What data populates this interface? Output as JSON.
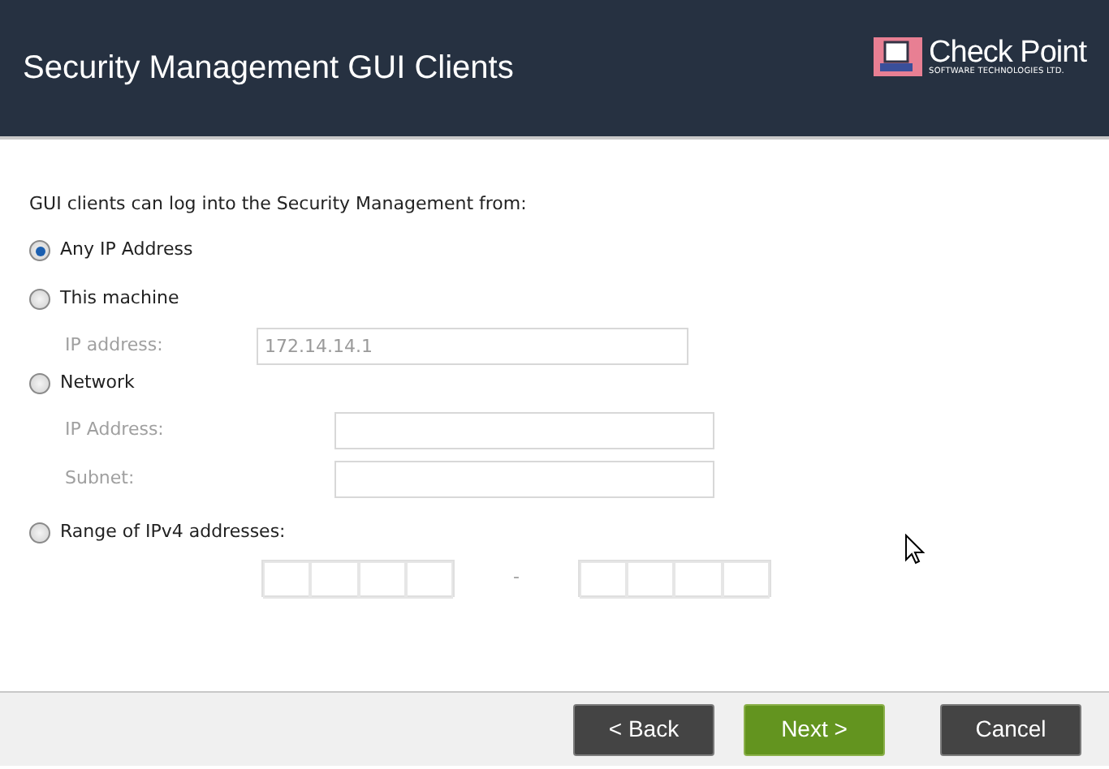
{
  "header": {
    "title": "Security Management GUI Clients",
    "logo": {
      "name": "Check Point",
      "tagline": "SOFTWARE TECHNOLOGIES LTD."
    }
  },
  "prompt": "GUI clients can log into the Security Management from:",
  "options": [
    {
      "kind": "plain",
      "label": "Any IP Address",
      "selected": true
    },
    {
      "kind": "fields",
      "label": "This machine",
      "selected": false,
      "fields": [
        {
          "label": "IP address:",
          "value": "172.14.14.1",
          "disabled": true
        }
      ]
    },
    {
      "kind": "fields",
      "label": "Network",
      "selected": false,
      "fields": [
        {
          "label": "IP Address:",
          "disabled": true
        },
        {
          "label": "Subnet:",
          "disabled": true
        }
      ]
    },
    {
      "kind": "range",
      "label": "Range of IPv4 addresses:",
      "selected": false,
      "separator": "-",
      "disabled": true
    }
  ],
  "buttons": [
    {
      "label": "< Back",
      "kind": "secondary"
    },
    {
      "label": "Next >",
      "kind": "primary"
    },
    {
      "label": "Cancel",
      "kind": "secondary"
    }
  ]
}
